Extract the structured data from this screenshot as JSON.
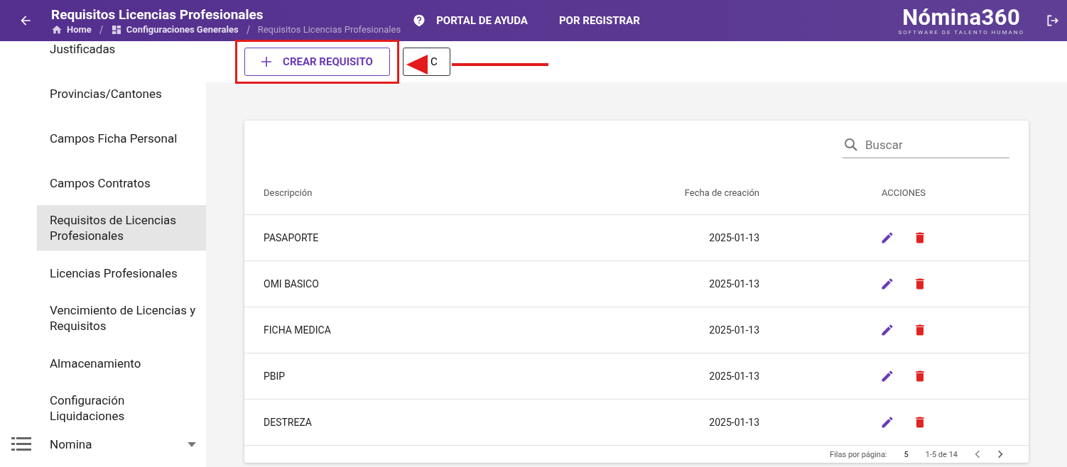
{
  "header": {
    "title": "Requisitos Licencias Profesionales",
    "breadcrumbs": [
      "Home",
      "Configuraciones Generales",
      "Requisitos Licencias Profesionales"
    ],
    "links": [
      "PORTAL DE AYUDA",
      "POR REGISTRAR"
    ],
    "logo": {
      "name": "Nómina360",
      "tagline": "SOFTWARE DE TALENTO HUMANO"
    }
  },
  "sidebar": {
    "items": [
      {
        "label": "Justificadas",
        "selected": false
      },
      {
        "label": "Provincias/Cantones",
        "selected": false
      },
      {
        "label": "Campos Ficha Personal",
        "selected": false
      },
      {
        "label": "Campos Contratos",
        "selected": false
      },
      {
        "label": "Requisitos de Licencias Profesionales",
        "selected": true
      },
      {
        "label": "Licencias Profesionales",
        "selected": false
      },
      {
        "label": "Vencimiento de Licencias y Requisitos",
        "selected": false
      },
      {
        "label": "Almacenamiento",
        "selected": false
      },
      {
        "label": "Configuración Liquidaciones",
        "selected": false
      }
    ],
    "section": {
      "label": "Nomina",
      "expanded": false
    }
  },
  "toolbar": {
    "create_button": "CREAR REQUISITO",
    "second_button": "C"
  },
  "table": {
    "search": {
      "placeholder": "Buscar"
    },
    "columns": [
      "Descripción",
      "Fecha de creación",
      "ACCIONES"
    ],
    "rows": [
      {
        "description": "PASAPORTE",
        "date": "2025-01-13"
      },
      {
        "description": "OMI BASICO",
        "date": "2025-01-13"
      },
      {
        "description": "FICHA MEDICA",
        "date": "2025-01-13"
      },
      {
        "description": "PBIP",
        "date": "2025-01-13"
      },
      {
        "description": "DESTREZA",
        "date": "2025-01-13"
      }
    ],
    "pagination": {
      "rows_label": "Filas por página:",
      "rows_value": "5",
      "range": "1-5 de 14"
    }
  }
}
